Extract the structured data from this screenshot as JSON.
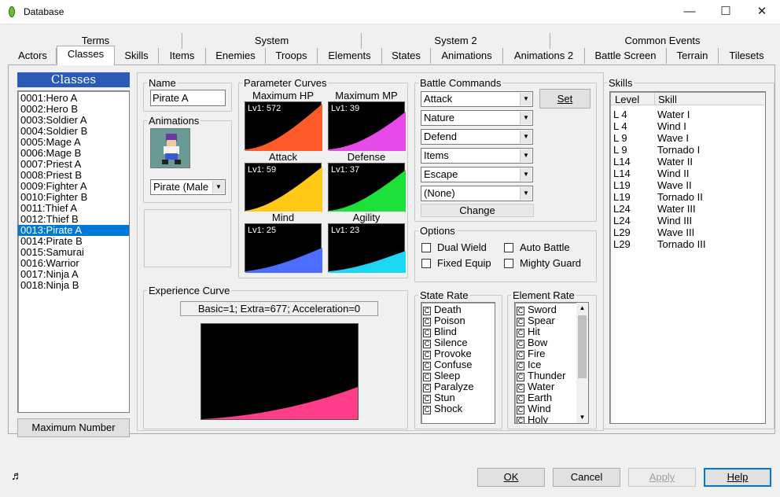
{
  "window": {
    "title": "Database",
    "minimize": "—",
    "maximize": "☐",
    "close": "✕"
  },
  "tabs_row1": [
    {
      "label": "Terms"
    },
    {
      "label": "System"
    },
    {
      "label": "System 2"
    },
    {
      "label": "Common Events"
    }
  ],
  "tabs_row2": [
    {
      "label": "Actors"
    },
    {
      "label": "Classes"
    },
    {
      "label": "Skills"
    },
    {
      "label": "Items"
    },
    {
      "label": "Enemies"
    },
    {
      "label": "Troops"
    },
    {
      "label": "Elements"
    },
    {
      "label": "States"
    },
    {
      "label": "Animations"
    },
    {
      "label": "Animations 2"
    },
    {
      "label": "Battle Screen"
    },
    {
      "label": "Terrain"
    },
    {
      "label": "Tilesets"
    }
  ],
  "classes": {
    "header": "Classes",
    "items": [
      "0001:Hero A",
      "0002:Hero B",
      "0003:Soldier A",
      "0004:Soldier B",
      "0005:Mage A",
      "0006:Mage B",
      "0007:Priest A",
      "0008:Priest B",
      "0009:Fighter A",
      "0010:Fighter B",
      "0011:Thief A",
      "0012:Thief B",
      "0013:Pirate A",
      "0014:Pirate B",
      "0015:Samurai",
      "0016:Warrior",
      "0017:Ninja A",
      "0018:Ninja B"
    ],
    "selected_index": 12,
    "max_button": "Maximum Number"
  },
  "name": {
    "legend": "Name",
    "value": "Pirate A"
  },
  "animations": {
    "legend": "Animations",
    "value": "Pirate (Male"
  },
  "parameter_curves": {
    "legend": "Parameter Curves",
    "curves": [
      {
        "label": "Maximum HP",
        "lv": "Lv1: 572",
        "color": "#ff5a2a"
      },
      {
        "label": "Maximum MP",
        "lv": "Lv1: 39",
        "color": "#e64ae8"
      },
      {
        "label": "Attack",
        "lv": "Lv1: 59",
        "color": "#ffc916"
      },
      {
        "label": "Defense",
        "lv": "Lv1: 37",
        "color": "#1de03a"
      },
      {
        "label": "Mind",
        "lv": "Lv1: 25",
        "color": "#4c6dff"
      },
      {
        "label": "Agility",
        "lv": "Lv1: 23",
        "color": "#1ed7f0"
      }
    ]
  },
  "experience": {
    "legend": "Experience Curve",
    "params": "Basic=1; Extra=677; Acceleration=0",
    "color": "#ff3d88"
  },
  "battle_commands": {
    "legend": "Battle Commands",
    "commands": [
      "Attack",
      "Nature",
      "Defend",
      "Items",
      "Escape",
      "(None)"
    ],
    "set_button": "Set",
    "change_button": "Change"
  },
  "options": {
    "legend": "Options",
    "dual_wield": "Dual Wield",
    "auto_battle": "Auto Battle",
    "fixed_equip": "Fixed Equip",
    "mighty_guard": "Mighty Guard"
  },
  "state_rate": {
    "legend": "State Rate",
    "badge": "C",
    "items": [
      "Death",
      "Poison",
      "Blind",
      "Silence",
      "Provoke",
      "Confuse",
      "Sleep",
      "Paralyze",
      "Stun",
      "Shock"
    ]
  },
  "element_rate": {
    "legend": "Element Rate",
    "badge": "C",
    "items": [
      "Sword",
      "Spear",
      "Hit",
      "Bow",
      "Fire",
      "Ice",
      "Thunder",
      "Water",
      "Earth",
      "Wind",
      "Holy"
    ]
  },
  "skills": {
    "legend": "Skills",
    "col_level": "Level",
    "col_skill": "Skill",
    "rows": [
      {
        "level": "L 4",
        "skill": "Water I"
      },
      {
        "level": "L 4",
        "skill": "Wind I"
      },
      {
        "level": "L 9",
        "skill": "Wave I"
      },
      {
        "level": "L 9",
        "skill": "Tornado I"
      },
      {
        "level": "L14",
        "skill": "Water II"
      },
      {
        "level": "L14",
        "skill": "Wind II"
      },
      {
        "level": "L19",
        "skill": "Wave II"
      },
      {
        "level": "L19",
        "skill": "Tornado II"
      },
      {
        "level": "L24",
        "skill": "Water III"
      },
      {
        "level": "L24",
        "skill": "Wind III"
      },
      {
        "level": "L29",
        "skill": "Wave III"
      },
      {
        "level": "L29",
        "skill": "Tornado III"
      }
    ]
  },
  "footer": {
    "ok": "OK",
    "cancel": "Cancel",
    "apply": "Apply",
    "help": "Help",
    "music_icon": "♬"
  }
}
